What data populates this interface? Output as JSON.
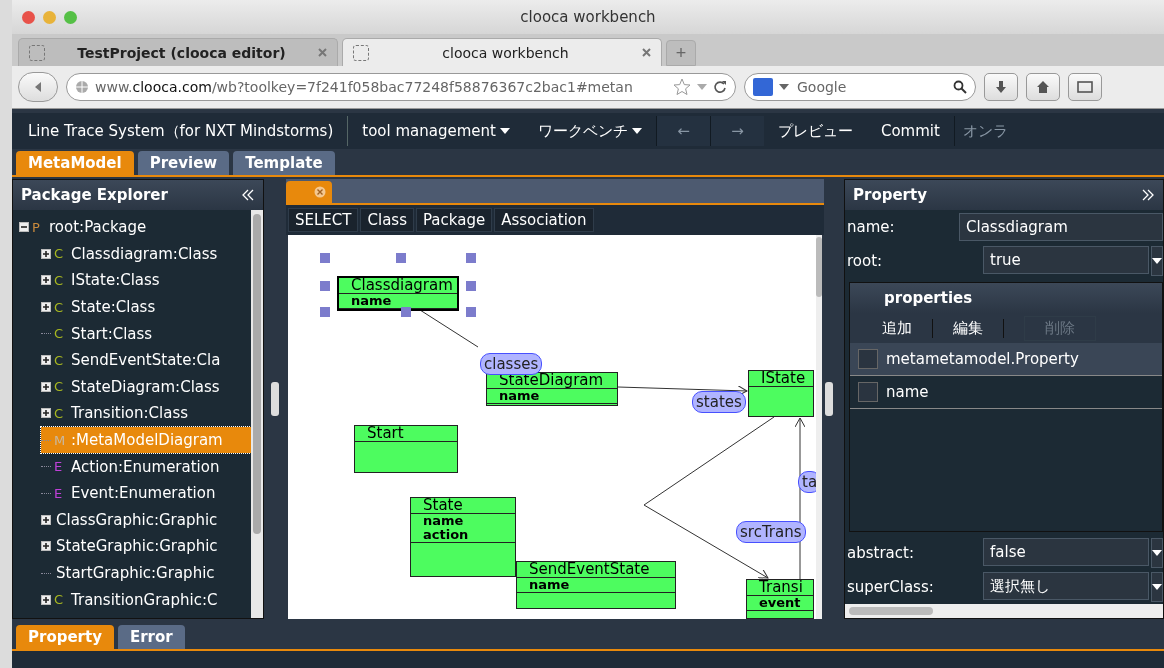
{
  "window": {
    "title": "clooca workbench"
  },
  "browser_tabs": [
    {
      "label": "TestProject (clooca editor)",
      "selected": false
    },
    {
      "label": "clooca workbench",
      "selected": true
    }
  ],
  "new_tab_button": "+",
  "address_bar": {
    "url": "www.**clooca.com**/wb?toolkey=7f241f058bac77248f58876367c2bac1#metan"
  },
  "search_field": {
    "placeholder": "Google"
  },
  "app_menu": [
    {
      "label": "Line Trace System（for NXT Mindstorms)",
      "kind": "title"
    },
    {
      "label": "tool management",
      "kind": "dropdown"
    },
    {
      "label": "ワークベンチ",
      "kind": "dropdown"
    },
    {
      "label": "←",
      "kind": "nav"
    },
    {
      "label": "→",
      "kind": "nav"
    },
    {
      "label": "プレビュー",
      "kind": "item"
    },
    {
      "label": "Commit",
      "kind": "item"
    },
    {
      "label": "オンラ",
      "kind": "dim"
    }
  ],
  "view_tabs": [
    {
      "label": "MetaModel",
      "selected": true
    },
    {
      "label": "Preview",
      "selected": false
    },
    {
      "label": "Template",
      "selected": false
    }
  ],
  "package_explorer": {
    "title": "Package Explorer",
    "tree": [
      {
        "label": "root:Package",
        "icon": "P",
        "color": "#c98a3c",
        "expanded": true,
        "selected": false,
        "children": [
          {
            "label": "Classdiagram:Class",
            "icon": "C",
            "color": "#a8b820",
            "expanded": false,
            "selected": false
          },
          {
            "label": "IState:Class",
            "icon": "C",
            "color": "#a8b820",
            "expanded": false,
            "selected": false
          },
          {
            "label": "State:Class",
            "icon": "C",
            "color": "#a8b820",
            "expanded": false,
            "selected": false
          },
          {
            "label": "Start:Class",
            "icon": "C",
            "color": "#a8b820",
            "selected": false
          },
          {
            "label": "SendEventState:Cla",
            "icon": "C",
            "color": "#a8b820",
            "expanded": false,
            "selected": false
          },
          {
            "label": "StateDiagram:Class",
            "icon": "C",
            "color": "#a8b820",
            "expanded": false,
            "selected": false
          },
          {
            "label": "Transition:Class",
            "icon": "C",
            "color": "#a8b820",
            "expanded": false,
            "selected": false
          },
          {
            "label": ":MetaModelDiagram",
            "icon": "M",
            "color": "#c8b8a0",
            "selected": true
          },
          {
            "label": "Action:Enumeration",
            "icon": "E",
            "color": "#c040d8",
            "selected": false
          },
          {
            "label": "Event:Enumeration",
            "icon": "E",
            "color": "#c040d8",
            "selected": false
          },
          {
            "label": "ClassGraphic:Graphic",
            "expanded": false,
            "selected": false
          },
          {
            "label": "StateGraphic:Graphic",
            "expanded": false,
            "selected": false
          },
          {
            "label": "StartGraphic:Graphic",
            "selected": false
          },
          {
            "label": "TransitionGraphic:C",
            "icon": "C",
            "color": "#a8b820",
            "expanded": false,
            "selected": false
          }
        ]
      }
    ]
  },
  "palette": [
    "SELECT",
    "Class",
    "Package",
    "Association"
  ],
  "diagram": {
    "nodes": [
      {
        "title": "Classdiagram",
        "attributes": [
          "name"
        ],
        "selected": true
      },
      {
        "title": "StateDiagram",
        "attributes": [
          "name"
        ],
        "selected": false
      },
      {
        "title": "IState",
        "selected": false
      },
      {
        "title": "Start",
        "selected": false
      },
      {
        "title": "State",
        "attributes": [
          "name",
          "action"
        ],
        "selected": false
      },
      {
        "title": "SendEventState",
        "attributes": [
          "name"
        ],
        "selected": false
      },
      {
        "title": "Transi",
        "attributes": [
          "event"
        ],
        "selected": false
      }
    ],
    "role_labels": [
      "classes",
      "states",
      "ta",
      "srcTrans"
    ]
  },
  "property_panel": {
    "title": "Property",
    "fields": [
      {
        "label": "name:",
        "value": "Classdiagram",
        "kind": "text"
      },
      {
        "label": "root:",
        "value": "true",
        "kind": "select"
      }
    ],
    "properties": {
      "title": "properties",
      "actions": [
        {
          "label": "追加",
          "disabled": false
        },
        {
          "label": "編集",
          "disabled": false
        },
        {
          "label": "削除",
          "disabled": true
        }
      ],
      "header": {
        "label": "metametamodel.Property",
        "checked": false
      },
      "rows": [
        {
          "value": "name",
          "checked": false
        }
      ]
    },
    "fields_after": [
      {
        "label": "abstract:",
        "value": "false",
        "kind": "select"
      },
      {
        "label": "superClass:",
        "value": "選択無し",
        "kind": "select"
      }
    ]
  },
  "bottom_tabs": [
    {
      "label": "Property",
      "selected": true
    },
    {
      "label": "Error",
      "selected": false
    }
  ]
}
